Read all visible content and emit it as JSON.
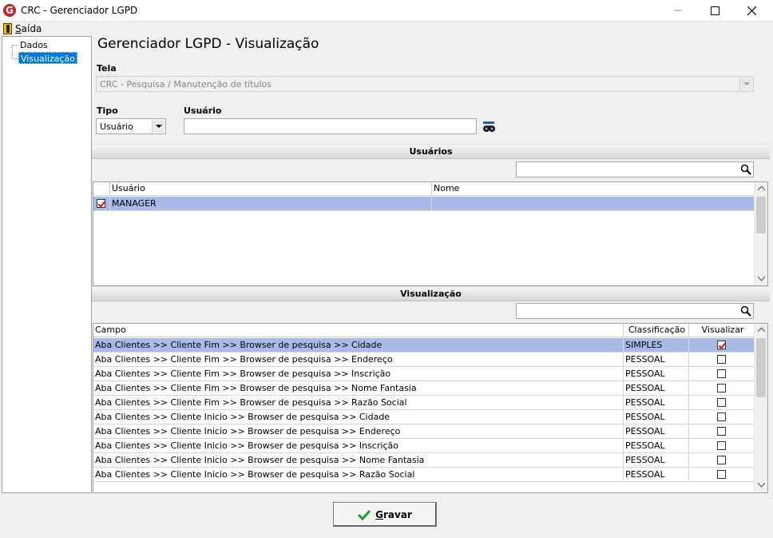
{
  "window": {
    "title": "CRC - Gerenciador LGPD",
    "app_icon_letter": "G"
  },
  "menu": {
    "items": [
      {
        "label_first": "S",
        "label_rest": "aída"
      }
    ]
  },
  "tree": {
    "items": [
      {
        "label": "Dados",
        "selected": false
      },
      {
        "label": "Visualização",
        "selected": true
      }
    ]
  },
  "page": {
    "title": "Gerenciador LGPD - Visualização",
    "tela_label": "Tela",
    "tela_value": "CRC - Pesquisa / Manutenção de títulos",
    "tipo_label": "Tipo",
    "tipo_value": "Usuário",
    "usuario_label": "Usuário",
    "usuario_value": ""
  },
  "usuarios": {
    "section_title": "Usuários",
    "search_value": "",
    "columns": [
      "",
      "Usuário",
      "Nome"
    ],
    "rows": [
      {
        "checked": true,
        "usuario": "MANAGER",
        "nome": "",
        "selected": true
      }
    ]
  },
  "visualizacao": {
    "section_title": "Visualização",
    "search_value": "",
    "columns": [
      "Campo",
      "Classificação",
      "Visualizar"
    ],
    "rows": [
      {
        "campo": "Aba Clientes >> Cliente Fim >> Browser de pesquisa >> Cidade",
        "classificacao": "SIMPLES",
        "visualizar": true,
        "selected": true
      },
      {
        "campo": "Aba Clientes >> Cliente Fim >> Browser de pesquisa >> Endereço",
        "classificacao": "PESSOAL",
        "visualizar": false,
        "selected": false
      },
      {
        "campo": "Aba Clientes >> Cliente Fim >> Browser de pesquisa >> Inscrição",
        "classificacao": "PESSOAL",
        "visualizar": false,
        "selected": false
      },
      {
        "campo": "Aba Clientes >> Cliente Fim >> Browser de pesquisa >> Nome Fantasia",
        "classificacao": "PESSOAL",
        "visualizar": false,
        "selected": false
      },
      {
        "campo": "Aba Clientes >> Cliente Fim >> Browser de pesquisa >> Razão Social",
        "classificacao": "PESSOAL",
        "visualizar": false,
        "selected": false
      },
      {
        "campo": "Aba Clientes >> Cliente Inicio >> Browser de pesquisa >> Cidade",
        "classificacao": "PESSOAL",
        "visualizar": false,
        "selected": false
      },
      {
        "campo": "Aba Clientes >> Cliente Inicio >> Browser de pesquisa >> Endereço",
        "classificacao": "PESSOAL",
        "visualizar": false,
        "selected": false
      },
      {
        "campo": "Aba Clientes >> Cliente Inicio >> Browser de pesquisa >> Inscrição",
        "classificacao": "PESSOAL",
        "visualizar": false,
        "selected": false
      },
      {
        "campo": "Aba Clientes >> Cliente Inicio >> Browser de pesquisa >> Nome Fantasia",
        "classificacao": "PESSOAL",
        "visualizar": false,
        "selected": false
      },
      {
        "campo": "Aba Clientes >> Cliente Inicio >> Browser de pesquisa >> Razão Social",
        "classificacao": "PESSOAL",
        "visualizar": false,
        "selected": false
      }
    ]
  },
  "footer": {
    "save_first": "G",
    "save_rest": "ravar"
  },
  "colors": {
    "selection": "#a8bbe8",
    "tree_selection": "#0078d7",
    "check_mark": "#dd1111",
    "app_icon": "#c1272d"
  }
}
